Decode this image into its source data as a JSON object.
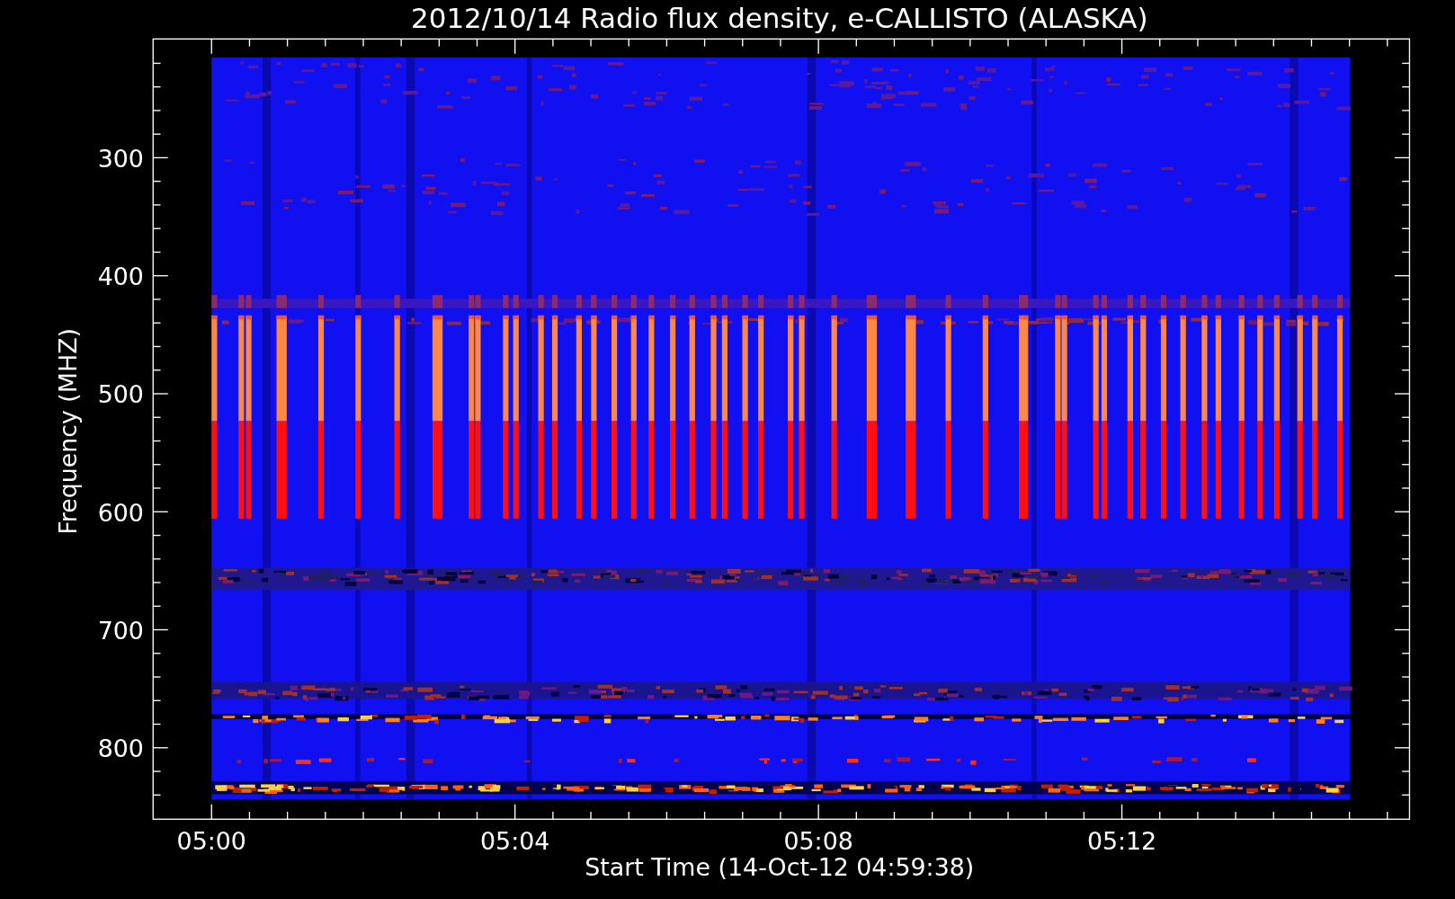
{
  "plot": {
    "title": "2012/10/14  Radio flux density, e-CALLISTO (ALASKA)",
    "xlabel": "Start Time (14-Oct-12 04:59:38)",
    "ylabel": "Frequency (MHZ)",
    "x_ticks": [
      "05:00",
      "05:04",
      "05:08",
      "05:12"
    ],
    "y_ticks": [
      "300",
      "400",
      "500",
      "600",
      "700",
      "800"
    ]
  }
}
